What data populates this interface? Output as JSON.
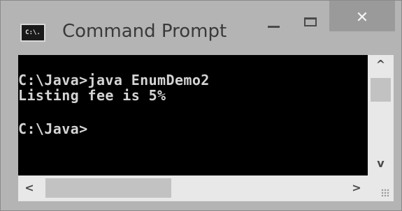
{
  "window": {
    "title": "Command Prompt",
    "app_icon_label": "C:\\."
  },
  "console": {
    "lines": [
      "C:\\Java>java EnumDemo2",
      "Listing fee is 5%",
      "C:\\Java>"
    ],
    "background": "#000000",
    "text_color": "#d4d4d4"
  },
  "controls": {
    "close_glyph": "✕"
  },
  "scrollbars": {
    "up_arrow": "^",
    "down_arrow": "v",
    "left_arrow": "<",
    "right_arrow": ">"
  },
  "icons": [
    "cmd-app-icon",
    "minimize-icon",
    "maximize-icon",
    "close-icon",
    "resize-grip-icon"
  ]
}
